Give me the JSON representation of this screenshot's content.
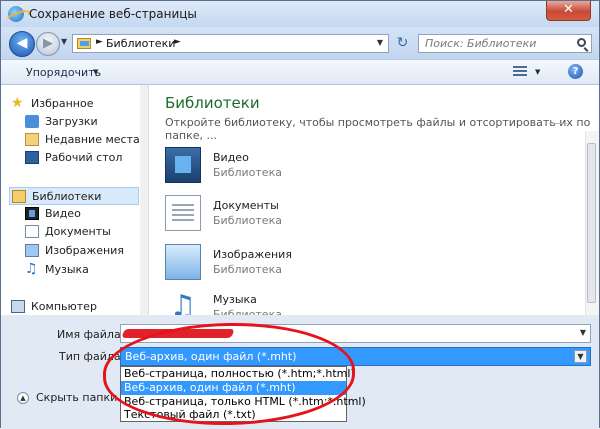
{
  "window": {
    "title": "Сохранение веб-страницы",
    "close_glyph": "✕"
  },
  "address": {
    "crumb": "Библиотеки",
    "search_placeholder": "Поиск: Библиотеки"
  },
  "toolbar": {
    "organize_label": "Упорядочить",
    "help_glyph": "?"
  },
  "nav": {
    "items": [
      {
        "label": "Избранное",
        "icon": "star-icon"
      },
      {
        "label": "Загрузки",
        "icon": "downloads-icon"
      },
      {
        "label": "Недавние места",
        "icon": "recent-places-icon"
      },
      {
        "label": "Рабочий стол",
        "icon": "desktop-icon"
      },
      {
        "label": "Библиотеки",
        "icon": "libraries-icon"
      },
      {
        "label": "Видео",
        "icon": "video-icon"
      },
      {
        "label": "Документы",
        "icon": "documents-icon"
      },
      {
        "label": "Изображения",
        "icon": "images-icon"
      },
      {
        "label": "Музыка",
        "icon": "music-icon"
      },
      {
        "label": "Компьютер",
        "icon": "computer-icon"
      }
    ]
  },
  "main": {
    "title": "Библиотеки",
    "subtitle": "Откройте библиотеку, чтобы просмотреть файлы и отсортировать их по папке, ...",
    "libraries": [
      {
        "name": "Видео",
        "type": "Библиотека"
      },
      {
        "name": "Документы",
        "type": "Библиотека"
      },
      {
        "name": "Изображения",
        "type": "Библиотека"
      },
      {
        "name": "Музыка",
        "type": "Библиотека"
      }
    ]
  },
  "save": {
    "filename_label": "Имя файла:",
    "filetype_label": "Тип файла:",
    "filetype_value": "Веб-архив, один файл (*.mht)",
    "hide_folders_label": "Скрыть папки",
    "filetype_options": [
      "Веб-страница, полностью (*.htm;*.html)",
      "Веб-архив, один файл (*.mht)",
      "Веб-страница, только HTML (*.htm;*.html)",
      "Текстовый файл (*.txt)"
    ],
    "selected_option_index": 1
  },
  "colors": {
    "selection": "#3399ff",
    "annotation": "#e5141c",
    "library_title": "#1e6a2d"
  }
}
